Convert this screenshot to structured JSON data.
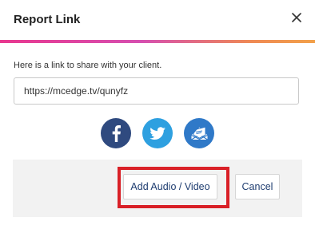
{
  "dialog": {
    "title": "Report Link",
    "close_icon": "close-icon"
  },
  "body": {
    "prompt": "Here is a link to share with your client.",
    "link_value": "https://mcedge.tv/qunyfz"
  },
  "share": [
    {
      "name": "facebook",
      "icon": "facebook-icon",
      "color": "#2f4a7f"
    },
    {
      "name": "twitter",
      "icon": "twitter-icon",
      "color": "#2ea0e0"
    },
    {
      "name": "email",
      "icon": "email-icon",
      "color": "#2f79c8"
    }
  ],
  "footer": {
    "add_label": "Add Audio / Video",
    "cancel_label": "Cancel"
  },
  "colors": {
    "accent_gradient": [
      "#e8388f",
      "#d64fb0",
      "#ef8a54",
      "#f2a14a"
    ],
    "button_text": "#1f3d70",
    "highlight": "#d92027"
  }
}
